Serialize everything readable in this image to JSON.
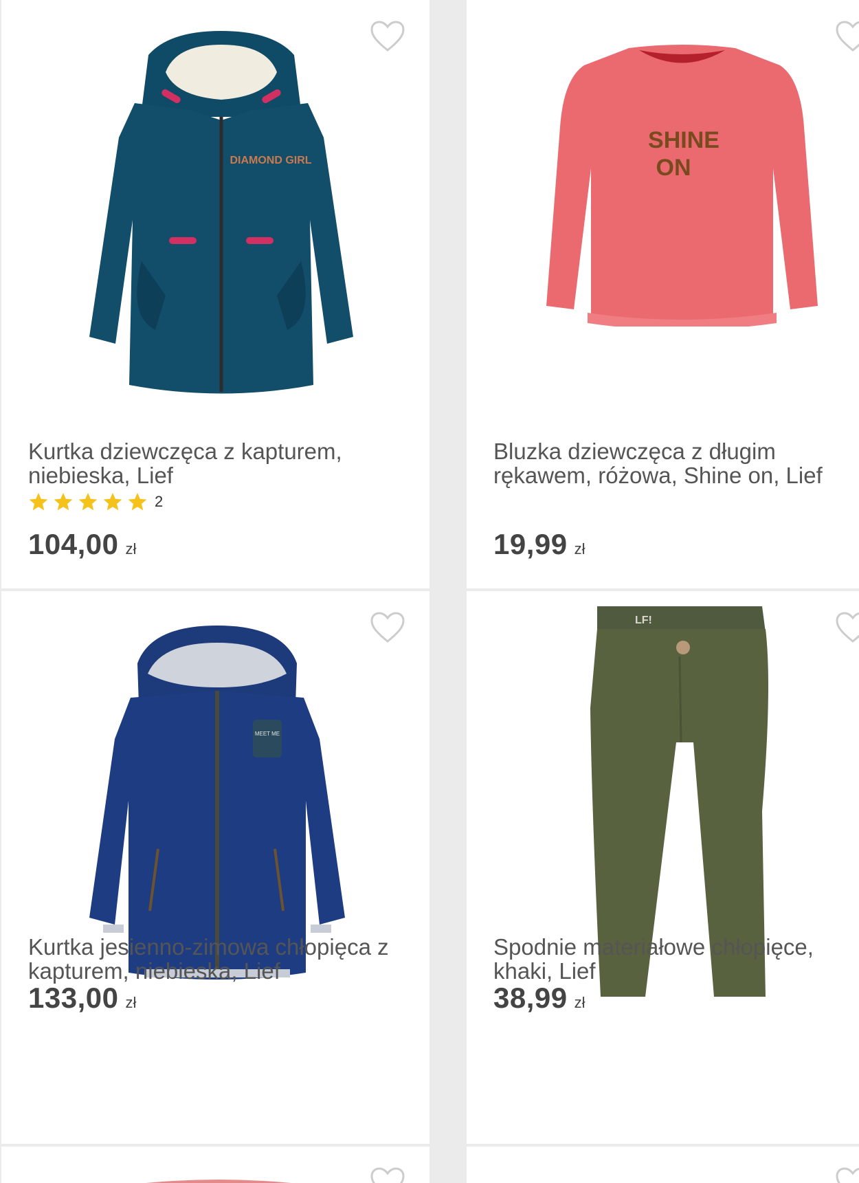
{
  "products": [
    {
      "title": "Kurtka dziewczęca z kapturem, niebieska, Lief",
      "rating_stars": 5,
      "rating_count": "2",
      "price": "104,00",
      "currency": "zł",
      "image_icon": "teal-hooded-jacket-image",
      "image_print": "DIAMOND GIRL"
    },
    {
      "title": "Bluzka dziewczęca z długim rękawem, różowa, Shine on, Lief",
      "price": "19,99",
      "currency": "zł",
      "image_icon": "pink-long-sleeve-shirt-image",
      "image_print_line1": "SHINE",
      "image_print_line2": "ON"
    },
    {
      "title": "Kurtka jesienno-zimowa chłopięca z kapturem, niebieska, Lief",
      "price": "133,00",
      "currency": "zł",
      "image_icon": "navy-hooded-jacket-image",
      "image_patch": "MEET ME"
    },
    {
      "title": "Spodnie materiałowe chłopięce, khaki, Lief",
      "price": "38,99",
      "currency": "zł",
      "image_icon": "khaki-trousers-image",
      "image_label": "LF!"
    }
  ],
  "colors": {
    "heart": "#cccccc",
    "star": "#f4c21b",
    "text": "#555555",
    "price": "#444444"
  }
}
